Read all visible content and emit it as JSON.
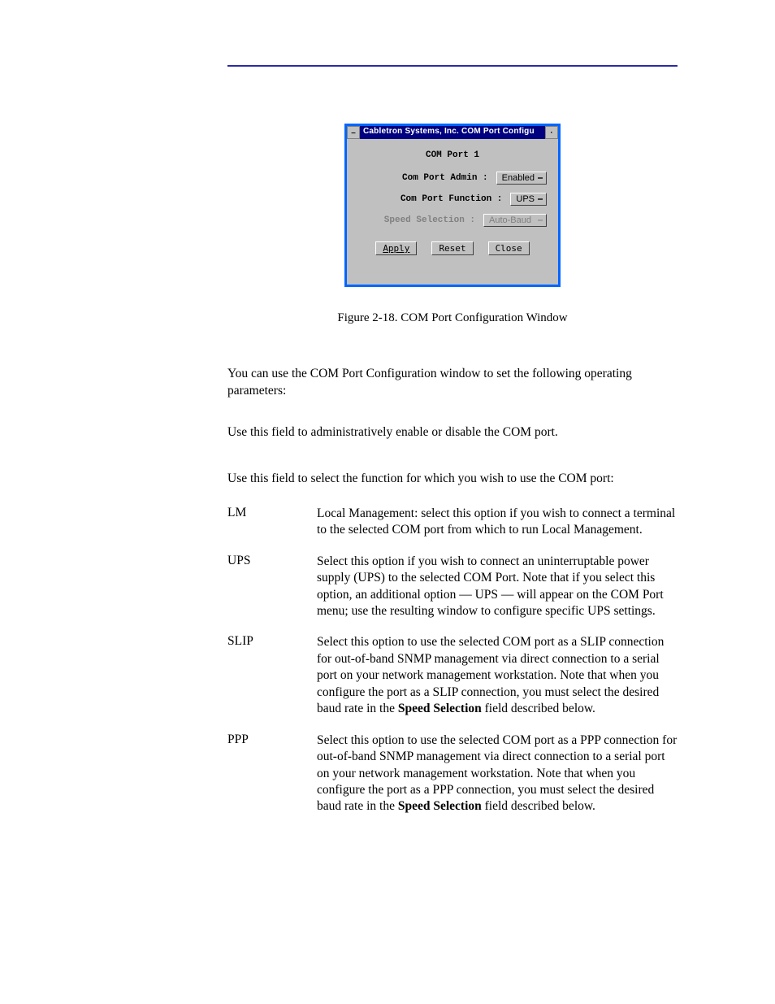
{
  "dialog": {
    "titlebar": "Cabletron Systems, Inc. COM Port Configu",
    "header": "COM Port 1",
    "rows": {
      "admin": {
        "label": "Com Port Admin :",
        "value": "Enabled"
      },
      "func": {
        "label": "Com Port Function :",
        "value": "UPS"
      },
      "speed": {
        "label": "Speed Selection :",
        "value": "Auto-Baud"
      }
    },
    "buttons": {
      "apply": "Apply",
      "reset": "Reset",
      "close": "Close"
    }
  },
  "caption": "Figure 2-18.  COM Port Configuration Window",
  "intro": "You can use the COM Port Configuration window to set the following operating parameters:",
  "admin_text": "Use this field to administratively enable or disable the COM port.",
  "func_text": "Use this field to select the function for which you wish to use the COM port:",
  "defs": {
    "lm": {
      "term": "LM",
      "desc": "Local Management: select this option if you wish to connect a terminal to the selected COM port from which to run Local Management."
    },
    "ups": {
      "term": "UPS",
      "desc": "Select this option if you wish to connect an uninterruptable power supply (UPS) to the selected COM Port. Note that if you select this option, an additional option — UPS — will appear on the COM Port menu; use the resulting window to configure specific UPS settings."
    },
    "slip": {
      "term": "SLIP",
      "desc_pre": "Select this option to use the selected COM port as a SLIP connection for out-of-band SNMP management via direct connection to a serial port on your network management workstation. Note that when you configure the port as a SLIP connection, you must select the desired baud rate in the ",
      "bold": "Speed Selection",
      "desc_post": " field described below."
    },
    "ppp": {
      "term": "PPP",
      "desc_pre": "Select this option to use the selected COM port as a PPP connection for out-of-band SNMP management via direct connection to a serial port on your network management workstation. Note that when you configure the port as a PPP connection, you must select the desired baud rate in the ",
      "bold": "Speed Selection",
      "desc_post": " field described below."
    }
  }
}
